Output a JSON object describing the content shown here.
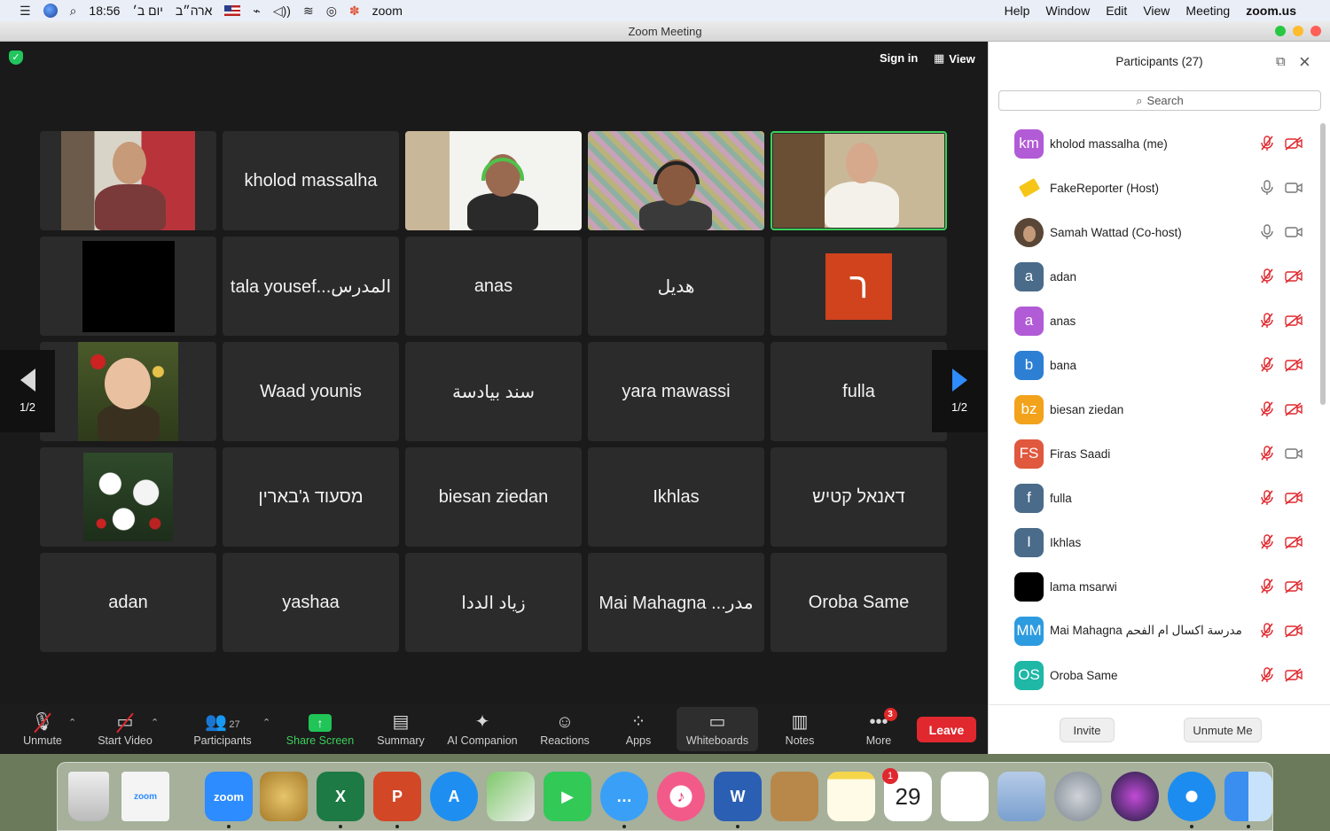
{
  "menubar": {
    "time": "18:56",
    "date_rtl": "יום ב׳",
    "keyboard_lang": "ארה״ב",
    "app_name": "zoom",
    "menus": [
      "Help",
      "Window",
      "Edit",
      "View",
      "Meeting",
      "zoom.us"
    ]
  },
  "window": {
    "title": "Zoom Meeting"
  },
  "meeting": {
    "sign_in": "Sign in",
    "view": "View",
    "page_indicator": "1/2",
    "tiles": [
      {
        "name": "",
        "kind": "video-man-shelves"
      },
      {
        "name": "kholod massalha",
        "kind": "name"
      },
      {
        "name": "",
        "kind": "video-headset-boy"
      },
      {
        "name": "",
        "kind": "video-headset-boy-colorful"
      },
      {
        "name": "",
        "kind": "video-woman",
        "active": true
      },
      {
        "name": "",
        "kind": "black-box"
      },
      {
        "name": "tala yousef...المدرس",
        "kind": "name"
      },
      {
        "name": "anas",
        "kind": "name"
      },
      {
        "name": "هديل",
        "kind": "name"
      },
      {
        "name": "ר",
        "kind": "orange-avatar"
      },
      {
        "name": "",
        "kind": "photo-baby"
      },
      {
        "name": "Waad younis",
        "kind": "name"
      },
      {
        "name": "سند بيادسة",
        "kind": "name"
      },
      {
        "name": "yara mawassi",
        "kind": "name"
      },
      {
        "name": "fulla",
        "kind": "name"
      },
      {
        "name": "",
        "kind": "photo-flowers"
      },
      {
        "name": "מסעוד ג'בארין",
        "kind": "name"
      },
      {
        "name": "biesan ziedan",
        "kind": "name"
      },
      {
        "name": "Ikhlas",
        "kind": "name"
      },
      {
        "name": "דאנאל קטיש",
        "kind": "name"
      },
      {
        "name": "adan",
        "kind": "name"
      },
      {
        "name": "yashaa",
        "kind": "name"
      },
      {
        "name": "زياد الددا",
        "kind": "name"
      },
      {
        "name": "Mai Mahagna ...مدر",
        "kind": "name"
      },
      {
        "name": "Oroba Same",
        "kind": "name"
      }
    ]
  },
  "toolbar": {
    "unmute": "Unmute",
    "start_video": "Start Video",
    "participants": "Participants",
    "participants_count": "27",
    "share_screen": "Share Screen",
    "summary": "Summary",
    "ai_companion": "AI Companion",
    "reactions": "Reactions",
    "apps": "Apps",
    "whiteboards": "Whiteboards",
    "notes": "Notes",
    "more": "More",
    "more_badge": "3",
    "leave": "Leave"
  },
  "panel": {
    "title": "Participants (27)",
    "search_placeholder": "Search",
    "invite": "Invite",
    "unmute_me": "Unmute Me",
    "participants": [
      {
        "initials": "km",
        "name": "kholod massalha (me)",
        "color": "#b25bd6",
        "mic": "muted",
        "cam": "off"
      },
      {
        "initials": "",
        "name": "FakeReporter (Host)",
        "color": "#ffffff",
        "mic": "on",
        "cam": "on"
      },
      {
        "initials": "",
        "name": "Samah Wattad (Co-host)",
        "color": "#5a4636",
        "mic": "on",
        "cam": "on"
      },
      {
        "initials": "a",
        "name": "adan",
        "color": "#4a6b8a",
        "mic": "muted",
        "cam": "off"
      },
      {
        "initials": "a",
        "name": "anas",
        "color": "#b25bd6",
        "mic": "muted",
        "cam": "off"
      },
      {
        "initials": "b",
        "name": "bana",
        "color": "#2d7fd4",
        "mic": "muted",
        "cam": "off"
      },
      {
        "initials": "bz",
        "name": "biesan ziedan",
        "color": "#f2a21b",
        "mic": "muted",
        "cam": "off"
      },
      {
        "initials": "FS",
        "name": "Firas Saadi",
        "color": "#e0583e",
        "mic": "muted",
        "cam": "on"
      },
      {
        "initials": "f",
        "name": "fulla",
        "color": "#4a6b8a",
        "mic": "muted",
        "cam": "off"
      },
      {
        "initials": "I",
        "name": "Ikhlas",
        "color": "#4a6b8a",
        "mic": "muted",
        "cam": "off"
      },
      {
        "initials": "",
        "name": "lama msarwi",
        "color": "#000000",
        "mic": "muted",
        "cam": "off"
      },
      {
        "initials": "MM",
        "name": "Mai Mahagna مدرسة اكسال ام الفحم",
        "color": "#2d9be0",
        "mic": "muted",
        "cam": "off"
      },
      {
        "initials": "OS",
        "name": "Oroba Same",
        "color": "#1fb7a6",
        "mic": "muted",
        "cam": "off"
      }
    ]
  },
  "dock": {
    "calendar_month": "",
    "calendar_day": "29",
    "calendar_badge": "1",
    "zoom_label": "zoom",
    "items": [
      "trash",
      "zoom-installer",
      "zoom",
      "paintbrush",
      "excel",
      "powerpoint",
      "app-store",
      "maps",
      "facetime",
      "messages",
      "itunes",
      "word",
      "contacts",
      "notes",
      "calendar",
      "reminders",
      "preview",
      "launchpad",
      "siri",
      "safari",
      "finder"
    ]
  },
  "colors": {
    "accent_green": "#3ccf5a",
    "leave_red": "#e0282e",
    "share_green": "#21c457",
    "next_blue": "#2f8cff"
  }
}
